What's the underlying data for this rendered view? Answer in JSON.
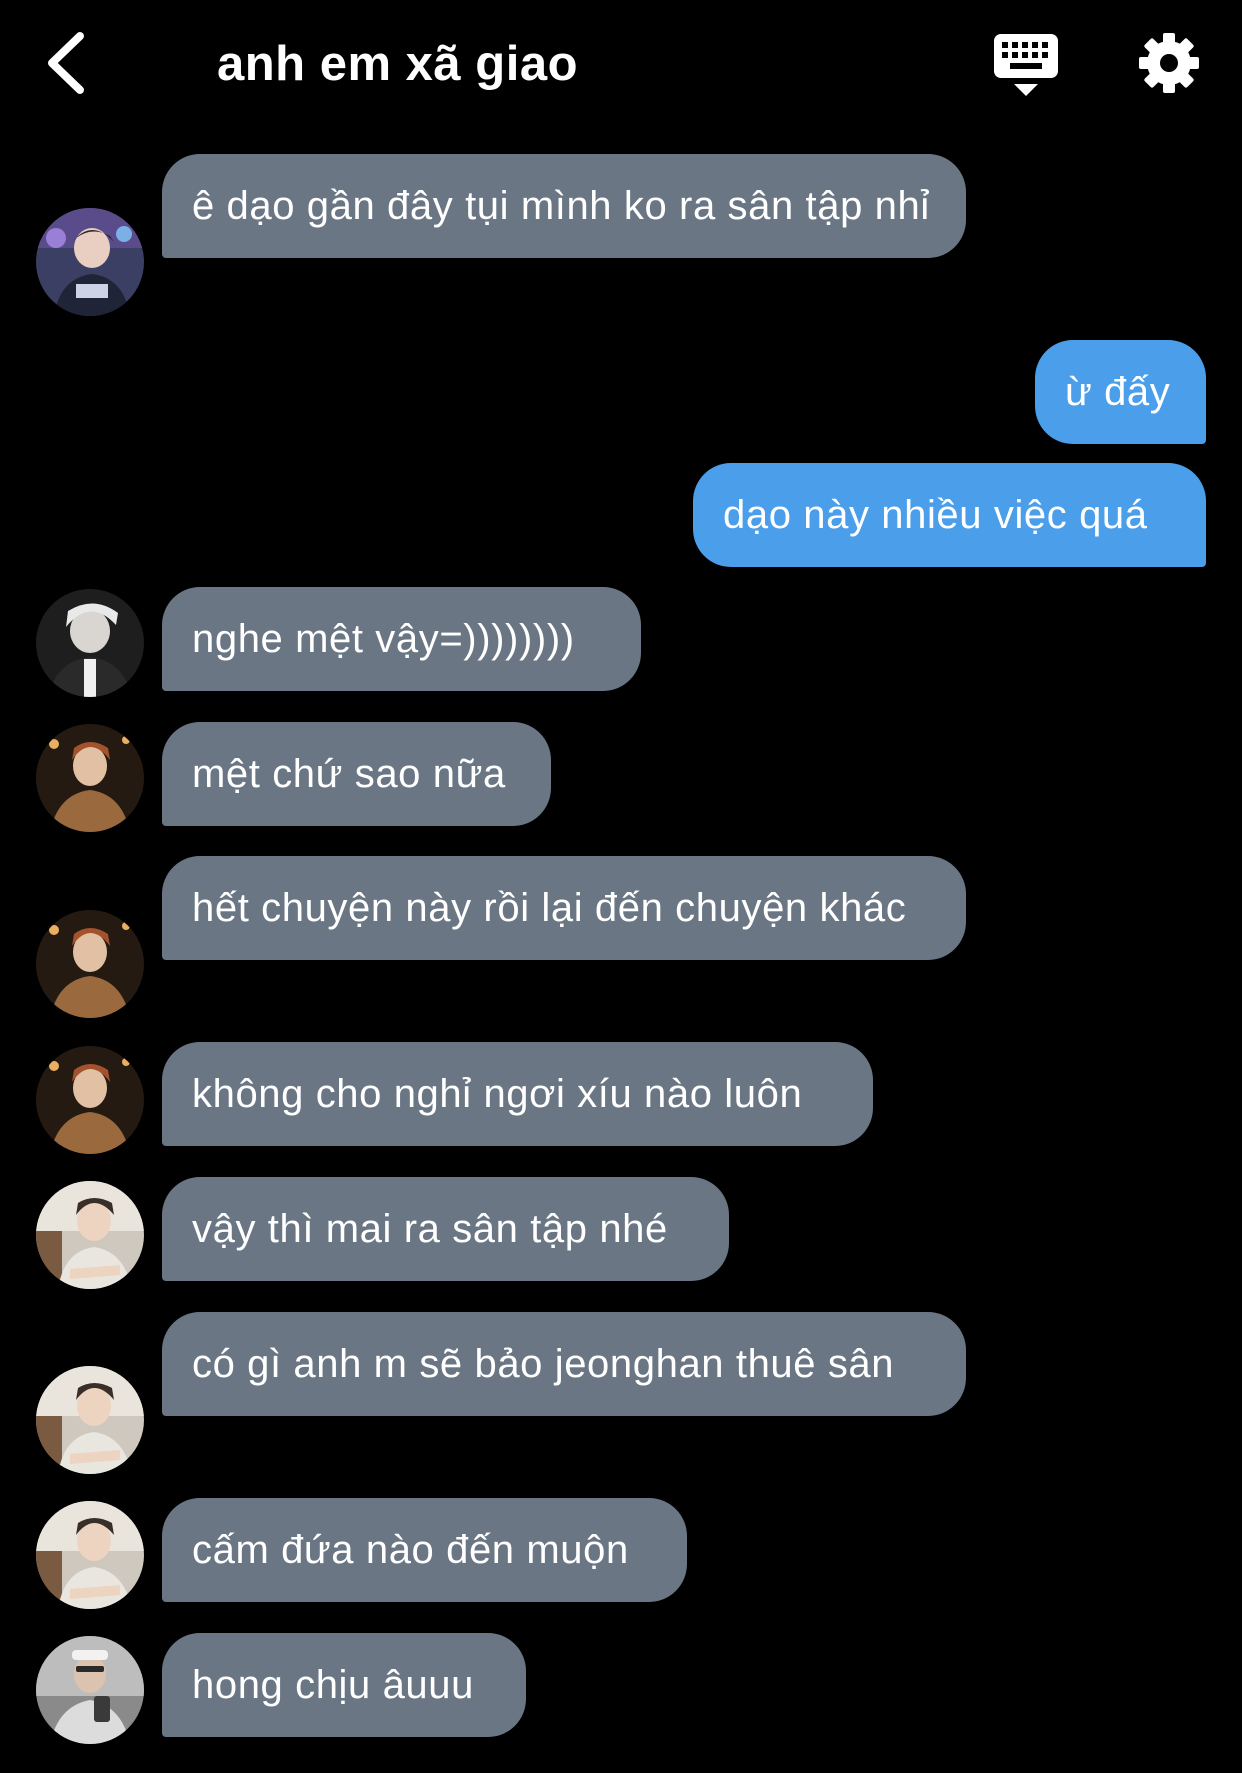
{
  "header": {
    "title": "anh em xã giao",
    "back_icon": "chevron-left-icon",
    "keyboard_icon": "keyboard-icon",
    "settings_icon": "gear-icon"
  },
  "colors": {
    "background": "#000000",
    "incoming_bubble": "#6a7684",
    "outgoing_bubble": "#4a9eea",
    "text": "#ffffff"
  },
  "messages": [
    {
      "direction": "in",
      "text": "ê dạo gần đây tụi mình ko ra sân tập nhỉ",
      "avatar": "member-1"
    },
    {
      "direction": "out",
      "text": "ừ đấy"
    },
    {
      "direction": "out",
      "text": "dạo này nhiều việc quá"
    },
    {
      "direction": "in",
      "text": "nghe mệt vậy=))))))))",
      "avatar": "member-2"
    },
    {
      "direction": "in",
      "text": "mệt chứ sao nữa",
      "avatar": "member-3"
    },
    {
      "direction": "in",
      "text": "hết chuyện này rồi lại đến chuyện khác",
      "avatar": "member-3"
    },
    {
      "direction": "in",
      "text": "không cho nghỉ ngơi xíu nào luôn",
      "avatar": "member-3"
    },
    {
      "direction": "in",
      "text": "vậy thì mai ra sân tập nhé",
      "avatar": "member-4"
    },
    {
      "direction": "in",
      "text": "có gì anh m sẽ bảo jeonghan thuê sân",
      "avatar": "member-4"
    },
    {
      "direction": "in",
      "text": "cấm đứa nào đến muộn",
      "avatar": "member-4"
    },
    {
      "direction": "in",
      "text": "hong chịu âuuu",
      "avatar": "member-5"
    }
  ]
}
